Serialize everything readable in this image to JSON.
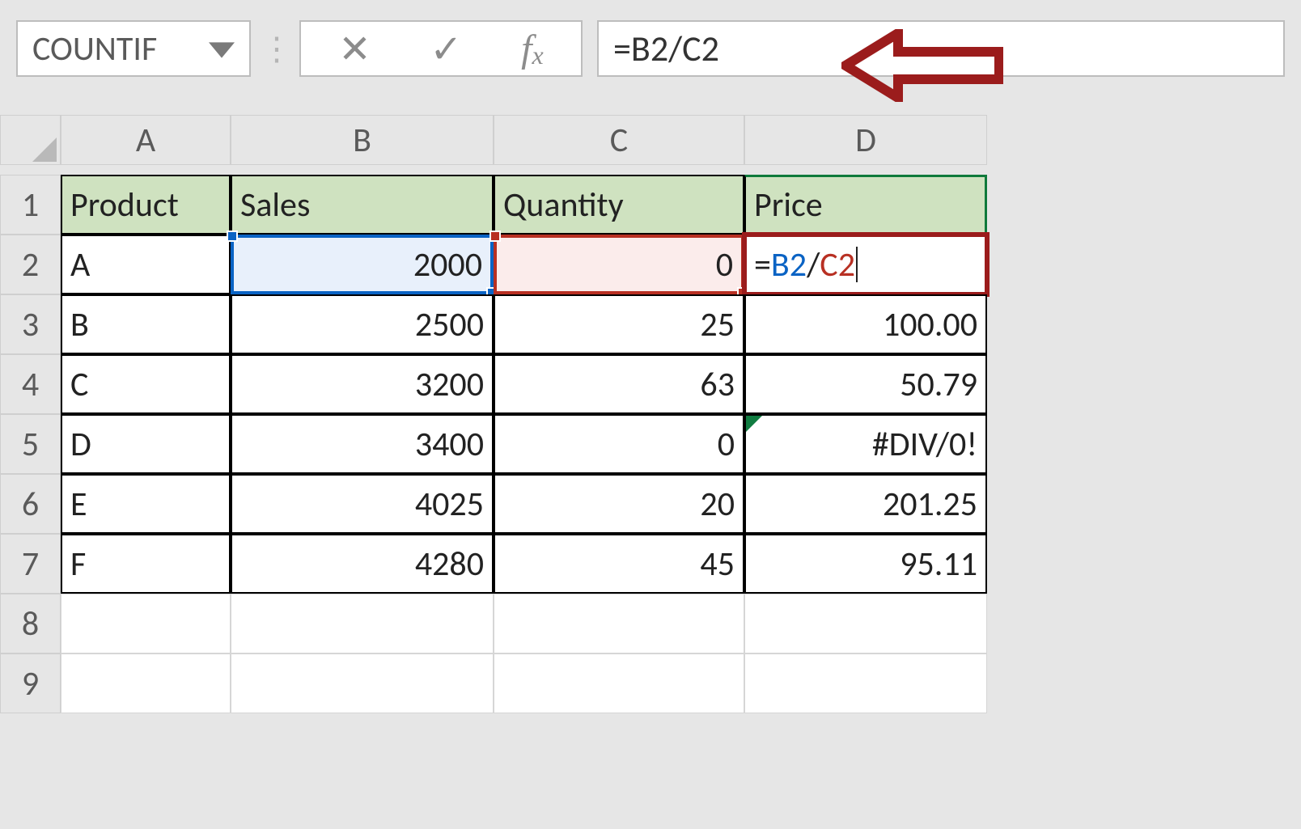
{
  "name_box": {
    "value": "COUNTIF"
  },
  "formula_bar": {
    "cancel_glyph": "✕",
    "confirm_glyph": "✓",
    "fx_label": "fx",
    "formula_text": "=B2/C2"
  },
  "columns": [
    "A",
    "B",
    "C",
    "D"
  ],
  "rows": [
    "1",
    "2",
    "3",
    "4",
    "5",
    "6",
    "7",
    "8",
    "9"
  ],
  "table": {
    "headers": {
      "A": "Product",
      "B": "Sales",
      "C": "Quantity",
      "D": "Price"
    },
    "data": [
      {
        "product": "A",
        "sales": "2000",
        "qty": "0",
        "price_formula": {
          "prefix": "=",
          "ref1": "B2",
          "op": "/",
          "ref2": "C2"
        }
      },
      {
        "product": "B",
        "sales": "2500",
        "qty": "25",
        "price": "100.00"
      },
      {
        "product": "C",
        "sales": "3200",
        "qty": "63",
        "price": "50.79"
      },
      {
        "product": "D",
        "sales": "3400",
        "qty": "0",
        "price": "#DIV/0!"
      },
      {
        "product": "E",
        "sales": "4025",
        "qty": "20",
        "price": "201.25"
      },
      {
        "product": "F",
        "sales": "4280",
        "qty": "45",
        "price": "95.11"
      }
    ]
  },
  "chart_data": {
    "type": "table",
    "columns": [
      "Product",
      "Sales",
      "Quantity",
      "Price"
    ],
    "rows": [
      [
        "A",
        2000,
        0,
        null
      ],
      [
        "B",
        2500,
        25,
        100.0
      ],
      [
        "C",
        3200,
        63,
        50.79
      ],
      [
        "D",
        3400,
        0,
        "#DIV/0!"
      ],
      [
        "E",
        4025,
        20,
        201.25
      ],
      [
        "F",
        4280,
        45,
        95.11
      ]
    ],
    "note": "Row A Price is being edited with formula =B2/C2 (division by zero)."
  }
}
